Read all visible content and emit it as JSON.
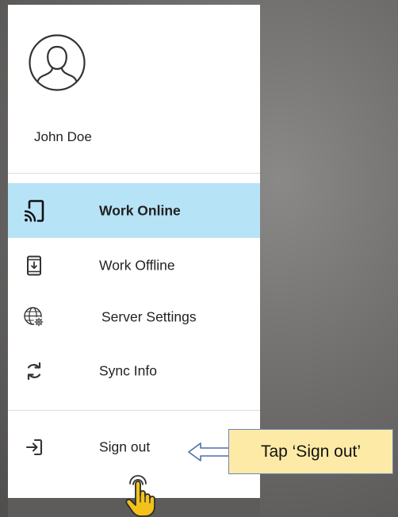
{
  "user": {
    "name": "John Doe",
    "avatar_icon": "user-avatar-icon"
  },
  "menu": {
    "items": [
      {
        "label": "Work Online",
        "icon": "cast-icon",
        "active": true
      },
      {
        "label": "Work Offline",
        "icon": "phone-download-icon",
        "active": false
      },
      {
        "label": "Server Settings",
        "icon": "globe-gear-icon",
        "active": false
      },
      {
        "label": "Sync Info",
        "icon": "sync-icon",
        "active": false
      }
    ],
    "sign_out": {
      "label": "Sign out",
      "icon": "sign-out-icon"
    }
  },
  "callout": {
    "text": "Tap ‘Sign out’"
  },
  "colors": {
    "active_bg": "#b7e3f7",
    "callout_bg": "#fdeaa6",
    "callout_border": "#6b86b8",
    "hand": "#f2c21b"
  }
}
